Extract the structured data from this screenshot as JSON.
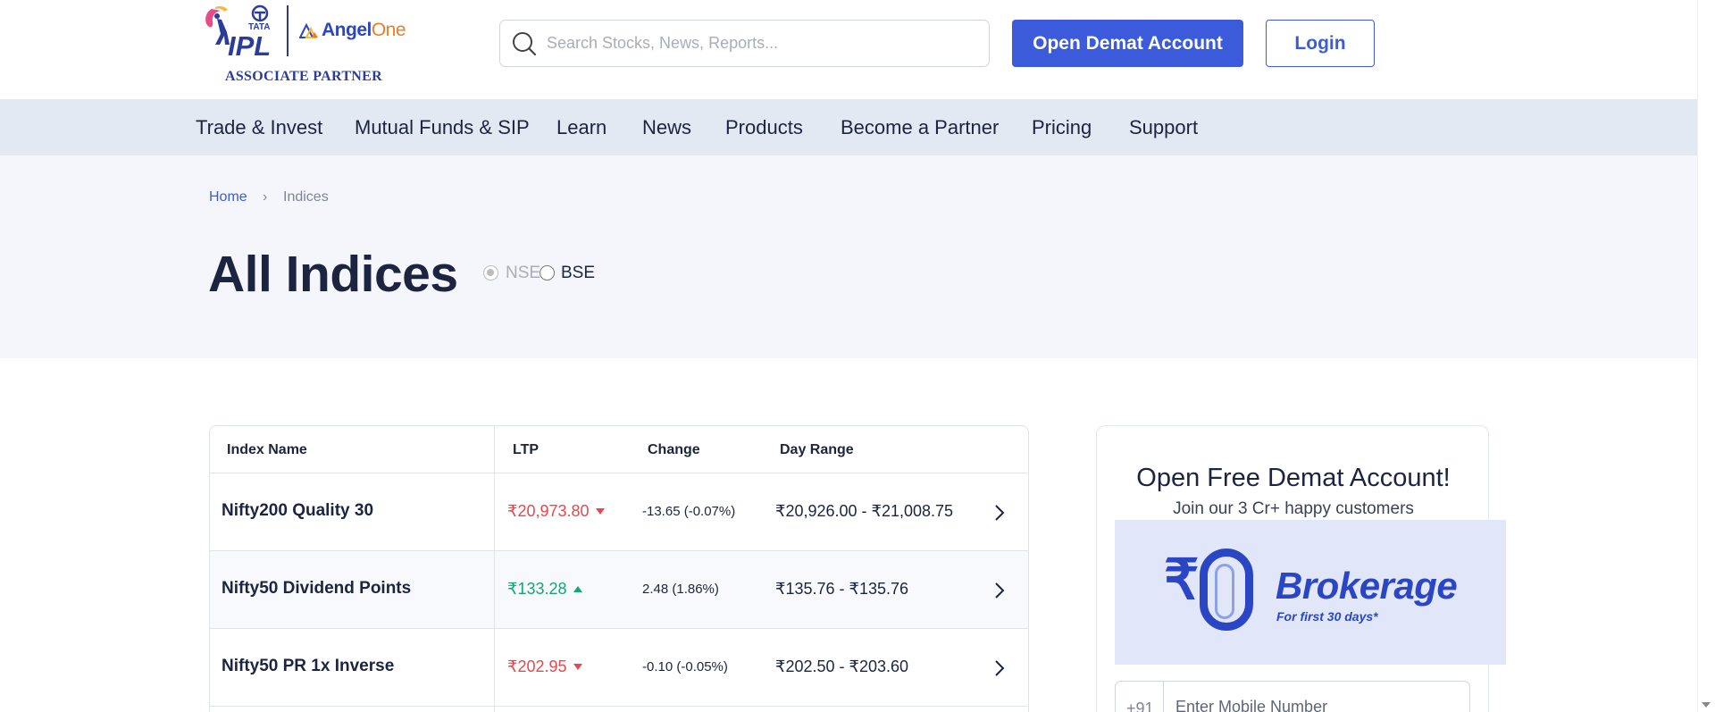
{
  "header": {
    "ipl_text": "IPL",
    "tata_text": "TATA",
    "brand_name_a": "Angel",
    "brand_name_b": "One",
    "associate_label": "ASSOCIATE PARTNER",
    "search_placeholder": "Search Stocks, News, Reports...",
    "open_demat_label": "Open Demat Account",
    "login_label": "Login"
  },
  "nav": {
    "items": [
      "Trade & Invest",
      "Mutual Funds & SIP",
      "Learn",
      "News",
      "Products",
      "Become a Partner",
      "Pricing",
      "Support"
    ]
  },
  "breadcrumb": {
    "home": "Home",
    "separator": "›",
    "current": "Indices"
  },
  "page_title": "All Indices",
  "exchange_toggle": {
    "options": [
      "NSE",
      "BSE"
    ],
    "selected": "NSE"
  },
  "table": {
    "columns": [
      "Index Name",
      "LTP",
      "Change",
      "Day Range"
    ],
    "rows": [
      {
        "name": "Nifty200 Quality 30",
        "ltp": "₹20,973.80",
        "direction": "down",
        "change": "-13.65 (-0.07%)",
        "range": "₹20,926.00 - ₹21,008.75"
      },
      {
        "name": "Nifty50 Dividend Points",
        "ltp": "₹133.28",
        "direction": "up",
        "change": "2.48 (1.86%)",
        "range": "₹135.76 - ₹135.76"
      },
      {
        "name": "Nifty50 PR 1x Inverse",
        "ltp": "₹202.95",
        "direction": "down",
        "change": "-0.10 (-0.05%)",
        "range": "₹202.50 - ₹203.60"
      }
    ]
  },
  "signup_card": {
    "title": "Open Free Demat Account!",
    "subtitle": "Join our 3 Cr+ happy customers",
    "banner_symbol": "₹",
    "banner_headline": "Brokerage",
    "banner_sub": "For first 30 days*",
    "country_code": "+91",
    "mobile_placeholder": "Enter Mobile Number"
  },
  "colors": {
    "primary": "#3b5bdb",
    "down": "#e5484d",
    "up": "#12a67a",
    "nav_bg": "#e3e9f3",
    "hero_bg": "#f4f6fb",
    "brand_orange": "#f27b22"
  }
}
